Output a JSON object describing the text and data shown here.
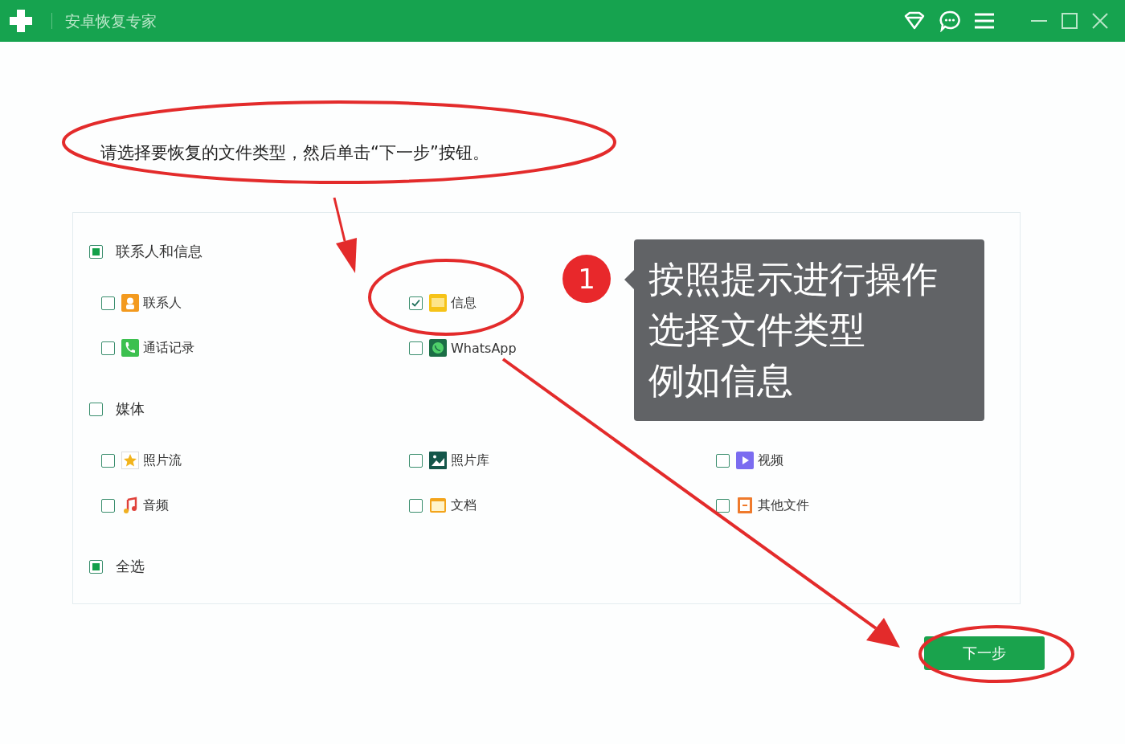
{
  "window": {
    "title": "安卓恢复专家"
  },
  "instruction": "请选择要恢复的文件类型，然后单击“下一步”按钮。",
  "groups": [
    {
      "label": "联系人和信息",
      "checked": false,
      "partial": true,
      "rows": [
        [
          {
            "label": "联系人",
            "kind": "contacts",
            "checked": false
          },
          {
            "label": "信息",
            "kind": "messages",
            "checked": true
          }
        ],
        [
          {
            "label": "通话记录",
            "kind": "calls",
            "checked": false
          },
          {
            "label": "WhatsApp",
            "kind": "whatsapp",
            "checked": false
          }
        ]
      ]
    },
    {
      "label": "媒体",
      "checked": false,
      "partial": false,
      "rows": [
        [
          {
            "label": "照片流",
            "kind": "photostream",
            "checked": false
          },
          {
            "label": "照片库",
            "kind": "gallery",
            "checked": false
          },
          {
            "label": "视频",
            "kind": "video",
            "checked": false
          }
        ],
        [
          {
            "label": "音频",
            "kind": "audio",
            "checked": false
          },
          {
            "label": "文档",
            "kind": "document",
            "checked": false
          },
          {
            "label": "其他文件",
            "kind": "other",
            "checked": false
          }
        ]
      ]
    }
  ],
  "select_all": {
    "label": "全选",
    "checked": false,
    "partial": true
  },
  "next_button": "下一步",
  "annotations": {
    "step_badge": "1",
    "callout": [
      "按照提示进行操作",
      "选择文件类型",
      "例如信息"
    ]
  }
}
